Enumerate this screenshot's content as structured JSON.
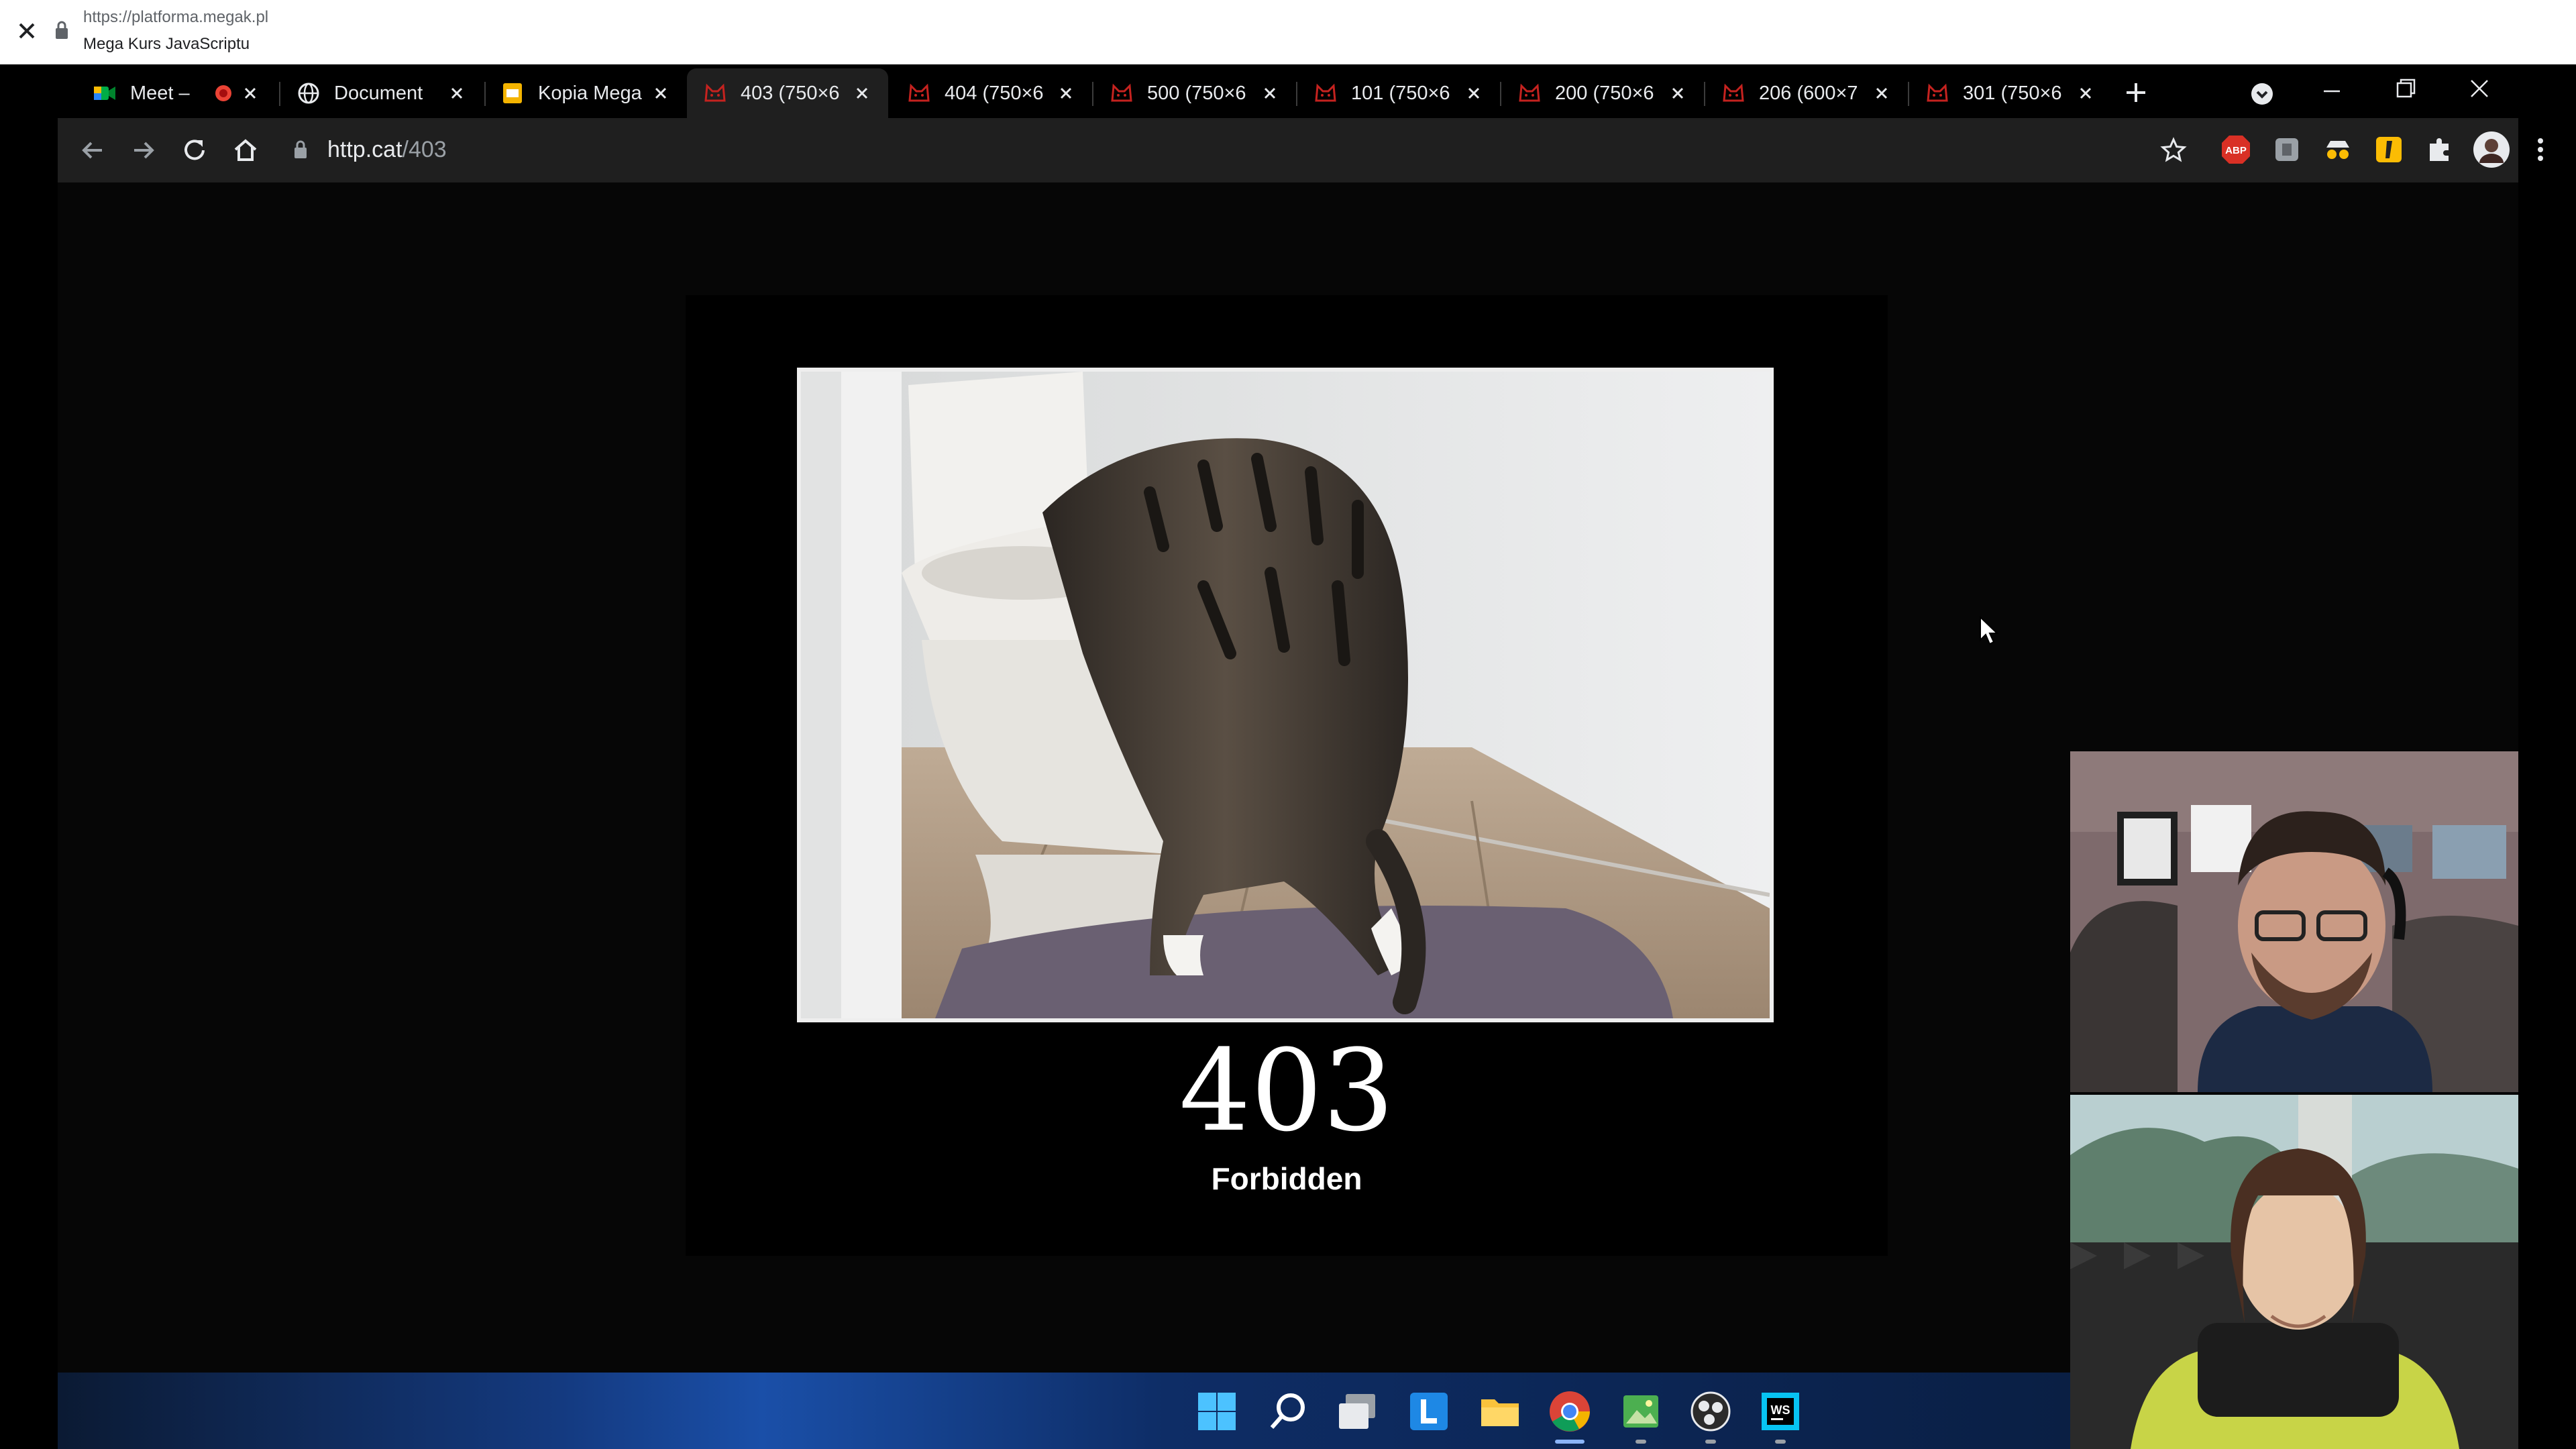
{
  "outer_bar": {
    "url": "https://platforma.megak.pl",
    "title": "Mega Kurs JavaScriptu"
  },
  "tabs": [
    {
      "label": "Meet –",
      "icon": "google-meet-icon"
    },
    {
      "label": "Document",
      "icon": "globe-icon"
    },
    {
      "label": "Kopia Mega",
      "icon": "slides-icon"
    },
    {
      "label": "403 (750×6",
      "icon": "http-cat-icon",
      "active": true
    },
    {
      "label": "404 (750×6",
      "icon": "http-cat-icon"
    },
    {
      "label": "500 (750×6",
      "icon": "http-cat-icon"
    },
    {
      "label": "101 (750×6",
      "icon": "http-cat-icon"
    },
    {
      "label": "200 (750×6",
      "icon": "http-cat-icon"
    },
    {
      "label": "206 (600×7",
      "icon": "http-cat-icon"
    },
    {
      "label": "301 (750×6",
      "icon": "http-cat-icon"
    }
  ],
  "omnibox": {
    "host": "http.cat",
    "path": "/403"
  },
  "page": {
    "code": "403",
    "reason": "Forbidden"
  },
  "extensions": [
    "adblock-plus-icon",
    "grey-extension-icon",
    "spy-extension-icon",
    "yellow-extension-icon",
    "puzzle-icon",
    "profile-avatar",
    "kebab-menu-icon"
  ],
  "taskbar": [
    "windows-start-icon",
    "search-icon",
    "task-view-icon",
    "l-app-icon",
    "file-explorer-icon",
    "chrome-icon",
    "image-viewer-icon",
    "obs-icon",
    "webstorm-icon"
  ],
  "colors": {
    "recording_dot": "#ea4335",
    "abp_badge": "#d93025",
    "cat_favicon": "#c5221f",
    "taskbar_blue": "#1a4fa8"
  }
}
